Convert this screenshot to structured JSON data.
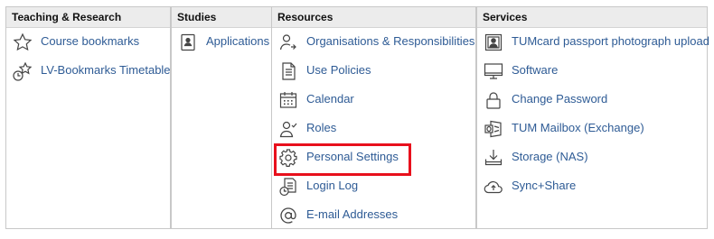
{
  "columns": [
    {
      "title": "Teaching & Research",
      "items": [
        {
          "label": "Course bookmarks",
          "icon": "star-icon"
        },
        {
          "label": "LV-Bookmarks Timetable",
          "icon": "clock-star-icon"
        }
      ]
    },
    {
      "title": "Studies",
      "items": [
        {
          "label": "Applications",
          "icon": "id-card-icon"
        }
      ]
    },
    {
      "title": "Resources",
      "items": [
        {
          "label": "Organisations & Responsibilities",
          "icon": "person-org-icon"
        },
        {
          "label": "Use Policies",
          "icon": "document-icon"
        },
        {
          "label": "Calendar",
          "icon": "calendar-icon"
        },
        {
          "label": "Roles",
          "icon": "person-check-icon"
        },
        {
          "label": "Personal Settings",
          "icon": "gear-icon"
        },
        {
          "label": "Login Log",
          "icon": "log-clock-icon"
        },
        {
          "label": "E-mail Addresses",
          "icon": "at-sign-icon"
        }
      ]
    },
    {
      "title": "Services",
      "items": [
        {
          "label": "TUMcard passport photograph upload",
          "icon": "portrait-icon"
        },
        {
          "label": "Software",
          "icon": "monitor-icon"
        },
        {
          "label": "Change Password",
          "icon": "lock-icon"
        },
        {
          "label": "TUM Mailbox (Exchange)",
          "icon": "exchange-icon"
        },
        {
          "label": "Storage (NAS)",
          "icon": "download-tray-icon"
        },
        {
          "label": "Sync+Share",
          "icon": "cloud-upload-icon"
        }
      ]
    }
  ],
  "highlight": {
    "target": "Personal Settings",
    "color": "#e8101c"
  },
  "colors": {
    "link": "#2e5b95",
    "header_bg": "#ececec",
    "border": "#c8c8c8"
  }
}
